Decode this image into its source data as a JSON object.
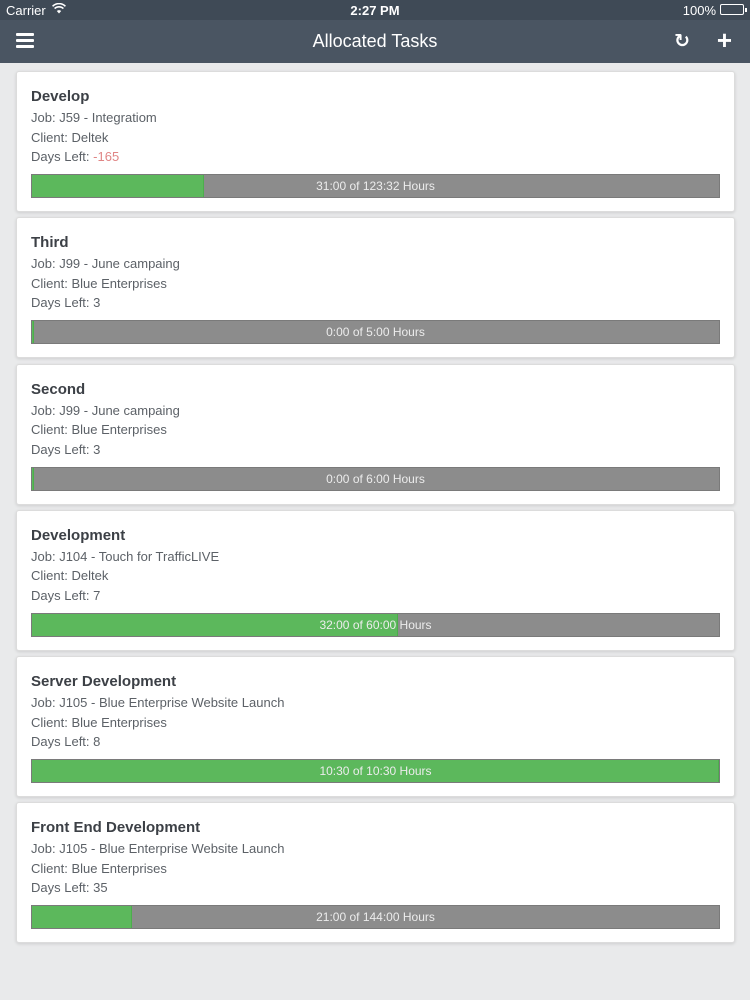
{
  "status_bar": {
    "carrier": "Carrier",
    "time": "2:27 PM",
    "battery": "100%"
  },
  "nav_bar": {
    "title": "Allocated Tasks",
    "refresh_icon": "refresh-icon",
    "add_icon": "plus-icon",
    "menu_icon": "hamburger-menu-icon"
  },
  "colors": {
    "nav": "#4a5562",
    "progress_complete": "#5cb85c",
    "progress_remaining": "#8c8c8c",
    "negative_days": "#e08585"
  },
  "tasks": [
    {
      "name": "Develop",
      "job_label": "Job:",
      "job": "J59 - Integratiom",
      "client_label": "Client:",
      "client": "Deltek",
      "days_label": "Days Left:",
      "days": "-165",
      "progress_text": "31:00 of 123:32 Hours",
      "progress": 0.25
    },
    {
      "name": "Third",
      "job_label": "Job:",
      "job": "J99 - June campaing",
      "client_label": "Client:",
      "client": "Blue Enterprises",
      "days_label": "Days Left:",
      "days": "3",
      "progress_text": "0:00 of 5:00 Hours",
      "progress": 0
    },
    {
      "name": "Second",
      "job_label": "Job:",
      "job": "J99 - June campaing",
      "client_label": "Client:",
      "client": "Blue Enterprises",
      "days_label": "Days Left:",
      "days": "3",
      "progress_text": "0:00 of 6:00 Hours",
      "progress": 0
    },
    {
      "name": "Development",
      "job_label": "Job:",
      "job": "J104 - Touch for TrafficLIVE",
      "client_label": "Client:",
      "client": "Deltek",
      "days_label": "Days Left:",
      "days": "7",
      "progress_text": "32:00 of 60:00 Hours",
      "progress": 0.533
    },
    {
      "name": "Server Development",
      "job_label": "Job:",
      "job": "J105 - Blue Enterprise Website Launch",
      "client_label": "Client:",
      "client": "Blue Enterprises",
      "days_label": "Days Left:",
      "days": "8",
      "progress_text": "10:30 of 10:30 Hours",
      "progress": 1
    },
    {
      "name": "Front End Development",
      "job_label": "Job:",
      "job": "J105 - Blue Enterprise Website Launch",
      "client_label": "Client:",
      "client": "Blue Enterprises",
      "days_label": "Days Left:",
      "days": "35",
      "progress_text": "21:00 of 144:00 Hours",
      "progress": 0.146
    }
  ]
}
